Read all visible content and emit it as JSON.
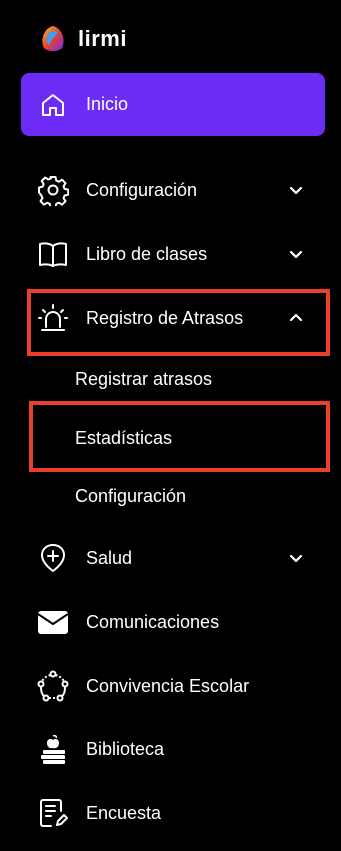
{
  "brand": {
    "name": "lirmi"
  },
  "nav": {
    "inicio": "Inicio",
    "configuracion": "Configuración",
    "libro": "Libro de clases",
    "registro": "Registro de Atrasos",
    "registro_sub": [
      "Registrar atrasos",
      "Estadísticas",
      "Configuración"
    ],
    "salud": "Salud",
    "comunicaciones": "Comunicaciones",
    "convivencia": "Convivencia Escolar",
    "biblioteca": "Biblioteca",
    "encuesta": "Encuesta"
  },
  "colors": {
    "accent": "#6c2cf5",
    "highlight": "#e8402c",
    "background": "#000000"
  }
}
